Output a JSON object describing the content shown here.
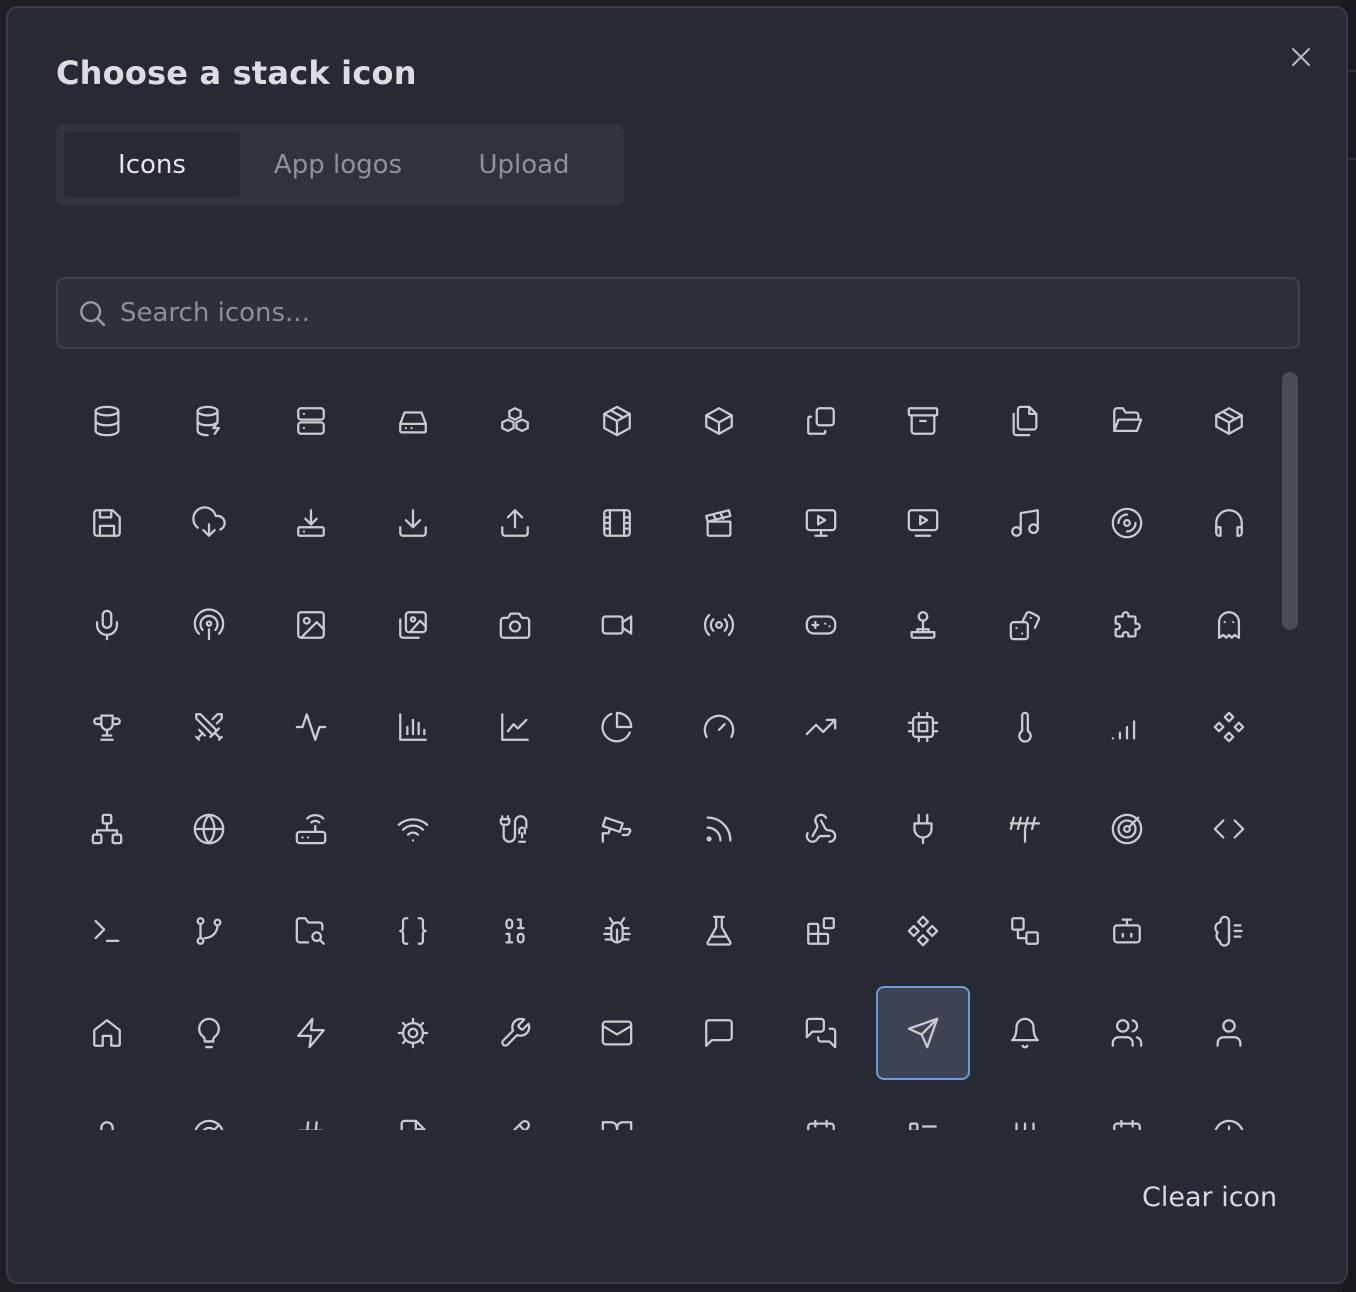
{
  "dialog": {
    "title": "Choose a stack icon",
    "close_icon": "close-icon"
  },
  "tabs": [
    {
      "label": "Icons",
      "active": true
    },
    {
      "label": "App logos",
      "active": false
    },
    {
      "label": "Upload",
      "active": false
    }
  ],
  "search": {
    "placeholder": "Search icons...",
    "value": "",
    "icon": "search-icon"
  },
  "icons": [
    "database",
    "database-zap",
    "server",
    "hard-drive",
    "boxes",
    "package-open",
    "box",
    "copy",
    "archive",
    "files",
    "folder-open",
    "package",
    "save",
    "cloud-download",
    "download-tray",
    "download",
    "upload",
    "film",
    "clapperboard",
    "monitor-play",
    "tv-play",
    "music",
    "disc",
    "headphones",
    "mic",
    "podcast",
    "image",
    "images",
    "camera",
    "video",
    "radio",
    "gamepad",
    "joystick",
    "dice",
    "puzzle",
    "ghost",
    "trophy",
    "swords",
    "activity",
    "bar-chart",
    "line-chart",
    "pie-chart",
    "gauge",
    "trending-up",
    "cpu",
    "thermometer",
    "signal",
    "workflow",
    "network",
    "globe",
    "router",
    "wifi",
    "cable",
    "cctv",
    "rss",
    "webhook",
    "plug",
    "rainbow-tally",
    "target",
    "code",
    "terminal",
    "git-branch",
    "folder-search",
    "braces",
    "binary",
    "bug",
    "flask",
    "blocks",
    "component",
    "shapes",
    "bot",
    "brain",
    "home",
    "lightbulb",
    "zap",
    "cog",
    "wrench",
    "mail",
    "message-square",
    "messages-square",
    "send",
    "bell",
    "users",
    "user",
    "lock",
    "radar",
    "hash",
    "file-code",
    "pencil",
    "book-open",
    "ruler",
    "calendar-range",
    "list",
    "columns",
    "calendar",
    "clock"
  ],
  "selected_icon": "send",
  "footer": {
    "clear_label": "Clear icon"
  }
}
